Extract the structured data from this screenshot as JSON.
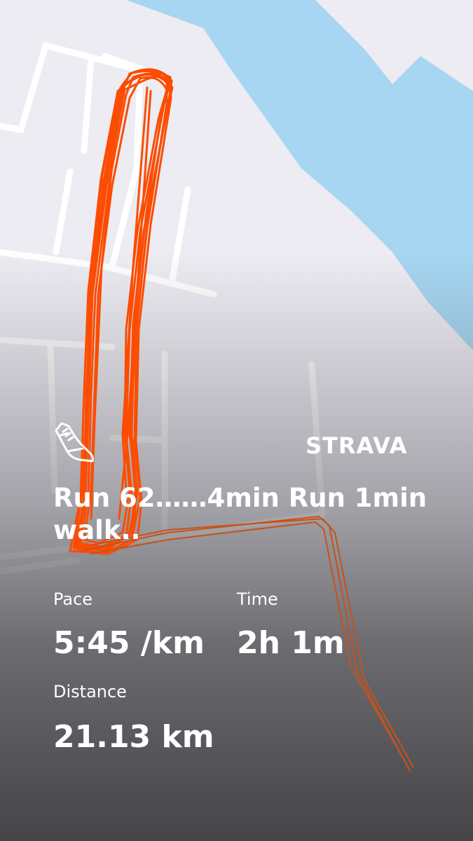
{
  "brand": {
    "logo_text": "STRAVA",
    "accent_color": "#fc4c02"
  },
  "activity": {
    "type_icon": "shoe-icon",
    "title": "Run 62……4min Run 1min walk.."
  },
  "stats": {
    "pace": {
      "label": "Pace",
      "value": "5:45 /km"
    },
    "time": {
      "label": "Time",
      "value": "2h 1m"
    },
    "distance": {
      "label": "Distance",
      "value": "21.13 km"
    }
  },
  "map": {
    "water_color": "#a6d6f2",
    "land_color": "#ececf2",
    "road_color": "#ffffff"
  }
}
